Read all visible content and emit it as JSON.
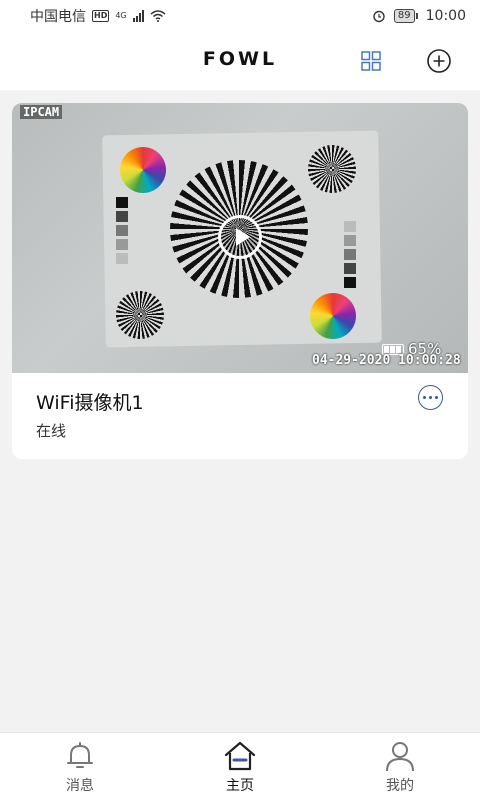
{
  "status_bar": {
    "carrier": "中国电信",
    "hd": "HD",
    "network": "4G",
    "battery": "89",
    "time": "10:00"
  },
  "header": {
    "brand": "FOWL"
  },
  "device": {
    "name": "WiFi摄像机1",
    "status": "在线",
    "preview": {
      "osd_label": "IPCAM",
      "battery_percent": "65%",
      "timestamp": "04-29-2020 10:00:28"
    }
  },
  "tabs": [
    {
      "label": "消息",
      "icon": "bell-icon",
      "active": false
    },
    {
      "label": "主页",
      "icon": "home-icon",
      "active": true
    },
    {
      "label": "我的",
      "icon": "person-icon",
      "active": false
    }
  ],
  "colors": {
    "accent": "#3a5a9b",
    "background": "#f2f2f2"
  }
}
